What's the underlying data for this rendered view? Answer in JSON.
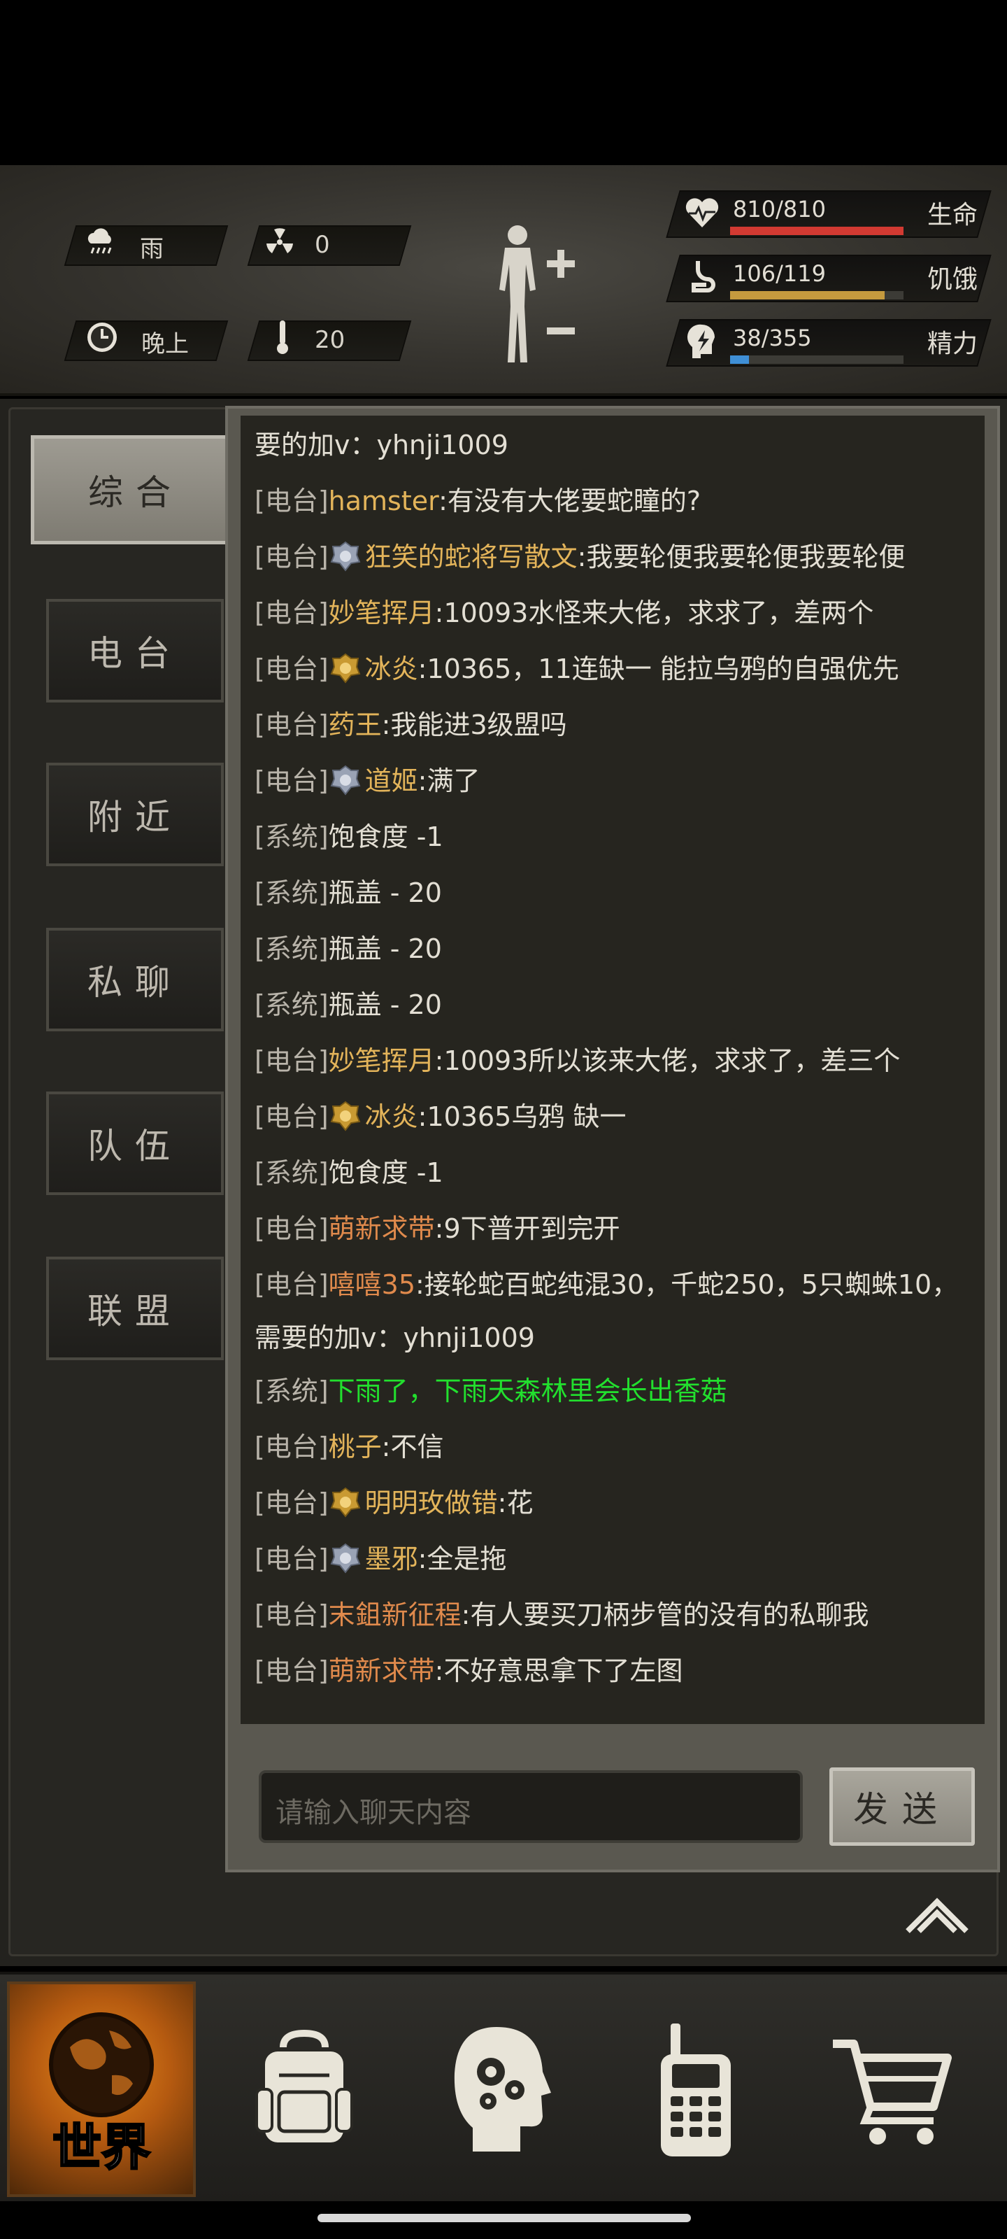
{
  "status": {
    "weather": "雨",
    "radiation": "0",
    "time_of_day": "晚上",
    "temperature": "20",
    "health": {
      "value": "810/810",
      "label": "生命",
      "fraction": 1.0,
      "color": "#d23a32"
    },
    "hunger": {
      "value": "106/119",
      "label": "饥饿",
      "fraction": 0.89,
      "color": "#c59a3e"
    },
    "energy": {
      "value": "38/355",
      "label": "精力",
      "fraction": 0.107,
      "color": "#3f8fd6"
    }
  },
  "tabs": [
    {
      "label": "综合",
      "active": true
    },
    {
      "label": "电台",
      "active": false
    },
    {
      "label": "附近",
      "active": false
    },
    {
      "label": "私聊",
      "active": false
    },
    {
      "label": "队伍",
      "active": false
    },
    {
      "label": "联盟",
      "active": false
    }
  ],
  "chat": {
    "messages": [
      {
        "channel": "",
        "name": "",
        "text": "要的加v：yhnji1009"
      },
      {
        "channel": "[电台]",
        "name": "hamster",
        "text": ":有没有大佬要蛇瞳的?"
      },
      {
        "channel": "[电台]",
        "badge": "silver",
        "name": "狂笑的蛇将写散文",
        "text": ":我要轮便我要轮便我要轮便"
      },
      {
        "channel": "[电台]",
        "name": "妙笔挥月",
        "text": ":10093水怪来大佬，求求了，差两个"
      },
      {
        "channel": "[电台]",
        "badge": "gold",
        "name": "冰炎",
        "text": ":10365，11连缺一 能拉乌鸦的自强优先"
      },
      {
        "channel": "[电台]",
        "name": "药王",
        "text": ":我能进3级盟吗"
      },
      {
        "channel": "[电台]",
        "badge": "silver",
        "name": "道姬",
        "text": ":满了"
      },
      {
        "channel": "[系统]",
        "name": "",
        "text": "饱食度 -1"
      },
      {
        "channel": "[系统]",
        "name": "",
        "text": "瓶盖 - 20"
      },
      {
        "channel": "[系统]",
        "name": "",
        "text": "瓶盖 - 20"
      },
      {
        "channel": "[系统]",
        "name": "",
        "text": "瓶盖 - 20"
      },
      {
        "channel": "[电台]",
        "name": "妙笔挥月",
        "text": ":10093所以该来大佬，求求了，差三个"
      },
      {
        "channel": "[电台]",
        "badge": "gold",
        "name": "冰炎",
        "text": ":10365乌鸦 缺一"
      },
      {
        "channel": "[系统]",
        "name": "",
        "text": "饱食度 -1"
      },
      {
        "channel": "[电台]",
        "name": "萌新求带",
        "text": ":9下普开到完开"
      },
      {
        "channel": "[电台]",
        "name": "嘻嘻35",
        "text": ":接轮蛇百蛇纯混30，千蛇250，5只蜘蛛10，需要的加v：yhnji1009"
      },
      {
        "channel": "[系统]",
        "name": "",
        "text": "下雨了，下雨天森林里会长出香菇"
      },
      {
        "channel": "[电台]",
        "name": "桃子",
        "text": ":不信"
      },
      {
        "channel": "[电台]",
        "badge": "gold",
        "name": "明明玫做错",
        "text": ":花"
      },
      {
        "channel": "[电台]",
        "badge": "silver",
        "name": "墨邪",
        "text": ":全是拖"
      },
      {
        "channel": "[电台]",
        "name": "末鉏新征程",
        "text": ":有人要买刀柄步管的没有的私聊我"
      },
      {
        "channel": "[电台]",
        "name": "萌新求带",
        "text": ":不好意思拿下了左图"
      }
    ],
    "input_placeholder": "请输入聊天内容",
    "send_label": "发送"
  },
  "nav": {
    "world_label": "世界"
  }
}
